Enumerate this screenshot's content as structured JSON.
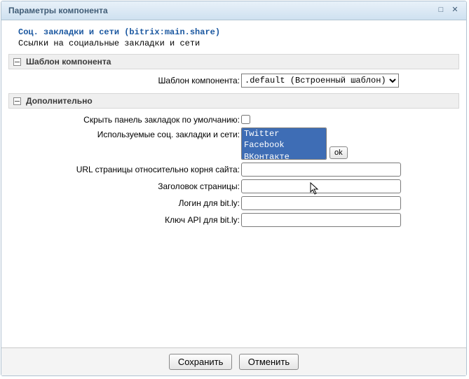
{
  "dialog": {
    "title": "Параметры компонента"
  },
  "component": {
    "name": "Соц. закладки и сети (bitrix:main.share)",
    "desc": "Ссылки на социальные закладки и сети"
  },
  "sections": {
    "template": {
      "title": "Шаблон компонента",
      "label_template": "Шаблон компонента:",
      "value_template": ".default (Встроенный шаблон)"
    },
    "extra": {
      "title": "Дополнительно",
      "label_hide": "Скрыть панель закладок по умолчанию:",
      "hide_checked": false,
      "label_services": "Используемые соц. закладки и сети:",
      "services": [
        "Twitter",
        "Facebook",
        "ВКонтакте"
      ],
      "ok_label": "ok",
      "label_url": "URL страницы относительно корня сайта:",
      "value_url": "",
      "label_pagetitle": "Заголовок страницы:",
      "value_pagetitle": "",
      "label_login": "Логин для bit.ly:",
      "value_login": "",
      "label_apikey": "Ключ API для bit.ly:",
      "value_apikey": ""
    }
  },
  "footer": {
    "save": "Сохранить",
    "cancel": "Отменить"
  }
}
